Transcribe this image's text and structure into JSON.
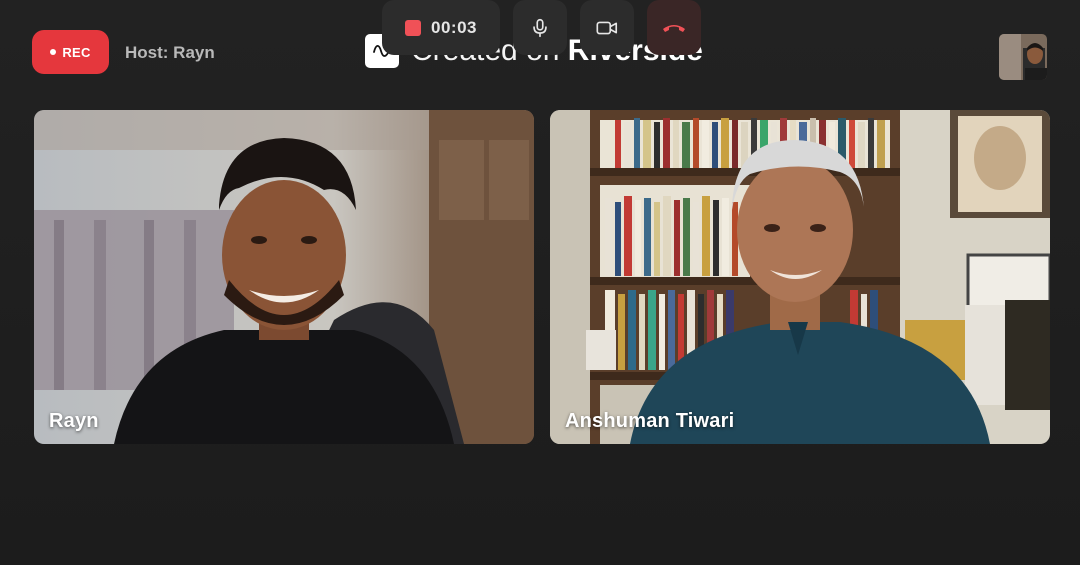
{
  "recording": {
    "badge_label": "REC",
    "host_label": "Host: Rayn"
  },
  "header": {
    "title_prefix": "Created on ",
    "title_brand": "Riverside"
  },
  "participants": [
    {
      "name": "Rayn"
    },
    {
      "name": "Anshuman Tiwari"
    }
  ],
  "controls": {
    "timer": "00:03",
    "icons": [
      "stop-recording-icon",
      "microphone-icon",
      "video-camera-icon",
      "end-call-icon"
    ]
  },
  "colors": {
    "accent": "#e5373d",
    "background": "#1f1f1f",
    "control_bg": "#2c2c2c",
    "end_call": "#f05157"
  }
}
